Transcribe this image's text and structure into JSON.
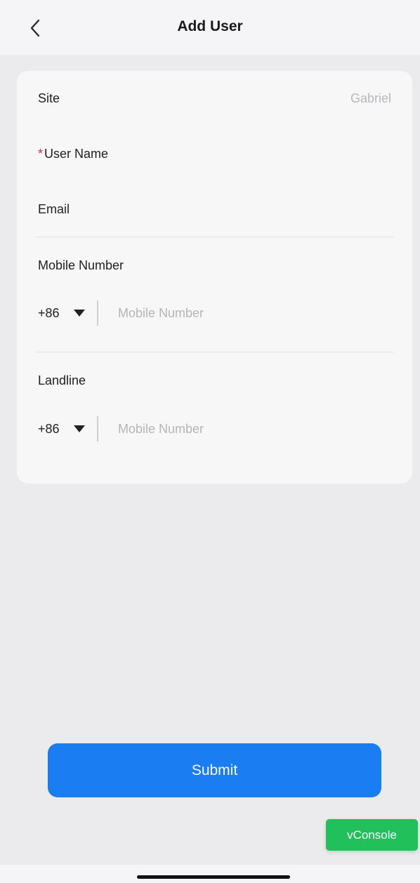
{
  "header": {
    "title": "Add User",
    "back_icon": "chevron-left-icon"
  },
  "form": {
    "site": {
      "label": "Site",
      "value": "Gabriel"
    },
    "user_name": {
      "required_mark": "*",
      "label": "User Name",
      "value": ""
    },
    "email": {
      "label": "Email",
      "value": ""
    },
    "mobile": {
      "label": "Mobile Number",
      "country_code": "+86",
      "placeholder": "Mobile Number",
      "value": ""
    },
    "landline": {
      "label": "Landline",
      "country_code": "+86",
      "placeholder": "Mobile Number",
      "value": ""
    }
  },
  "actions": {
    "submit_label": "Submit"
  },
  "debug": {
    "vconsole_label": "vConsole"
  },
  "colors": {
    "accent": "#1a7df2",
    "required": "#e0332a",
    "vconsole": "#21c05a"
  }
}
